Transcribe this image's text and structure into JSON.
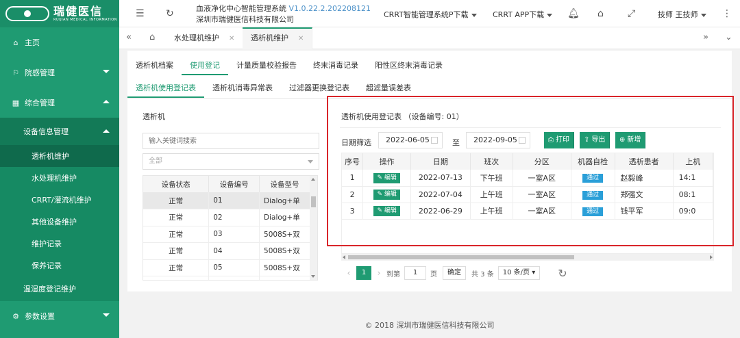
{
  "logo": {
    "cn": "瑞健医信",
    "en": "RUIJIAN MEDICAL INFORMATION"
  },
  "sidebar": {
    "home": "主页",
    "infection": "院感管理",
    "general": "综合管理",
    "device_group": "设备信息管理",
    "subs": [
      "透析机维护",
      "水处理机维护",
      "CRRT/灌流机维护",
      "其他设备维护",
      "维护记录",
      "保养记录"
    ],
    "temp": "温湿度登记维护",
    "params": "参数设置"
  },
  "topbar": {
    "sys_name": "血液净化中心智能管理系统",
    "version": "V1.0.22.2.202208121",
    "company": "深圳市瑞健医信科技有限公司",
    "crrt_smart": "CRRT智能管理系统",
    "p_download": "P下载",
    "crrt_app": "CRRT APP下载",
    "user": "技师 王技师"
  },
  "tabbar": {
    "tabs": [
      "水处理机维护",
      "透析机维护"
    ]
  },
  "tabs1": [
    "透析机档案",
    "使用登记",
    "计量质量校验报告",
    "终末消毒记录",
    "阳性区终末消毒记录"
  ],
  "tabs2": [
    "透析机使用登记表",
    "透析机消毒异常表",
    "过滤器更换登记表",
    "超滤量误差表"
  ],
  "left": {
    "title": "透析机",
    "search_placeholder": "输入关键词搜索",
    "select_value": "全部",
    "columns": [
      "设备状态",
      "设备编号",
      "设备型号"
    ],
    "rows": [
      [
        "正常",
        "01",
        "Dialog+单"
      ],
      [
        "正常",
        "02",
        "Dialog+单"
      ],
      [
        "正常",
        "03",
        "5008S+双"
      ],
      [
        "正常",
        "04",
        "5008S+双"
      ],
      [
        "正常",
        "05",
        "5008S+双"
      ],
      [
        "正常",
        "",
        ""
      ]
    ]
  },
  "right": {
    "title": "透析机使用登记表 （设备编号: 01）",
    "filter_label": "日期筛选",
    "date_from": "2022-06-05",
    "to_label": "至",
    "date_to": "2022-09-05",
    "buttons": {
      "print": "打印",
      "export": "导出",
      "add": "新增"
    },
    "columns": [
      "序号",
      "操作",
      "日期",
      "班次",
      "分区",
      "机器自检",
      "透析患者",
      "上机"
    ],
    "edit_label": "编辑",
    "rows": [
      [
        "1",
        "2022-07-13",
        "下午班",
        "一室A区",
        "通过",
        "赵毅峰",
        "14:1"
      ],
      [
        "2",
        "2022-07-04",
        "上午班",
        "一室A区",
        "通过",
        "郑强文",
        "08:1"
      ],
      [
        "3",
        "2022-06-29",
        "上午班",
        "一室A区",
        "通过",
        "钱平军",
        "09:0"
      ]
    ],
    "pager": {
      "current": "1",
      "goto_label": "到第",
      "goto_value": "1",
      "page_label": "页",
      "confirm": "确定",
      "total": "共 3 条",
      "page_size": "10 条/页"
    }
  },
  "footer": "© 2018 深圳市瑞健医信科技有限公司"
}
